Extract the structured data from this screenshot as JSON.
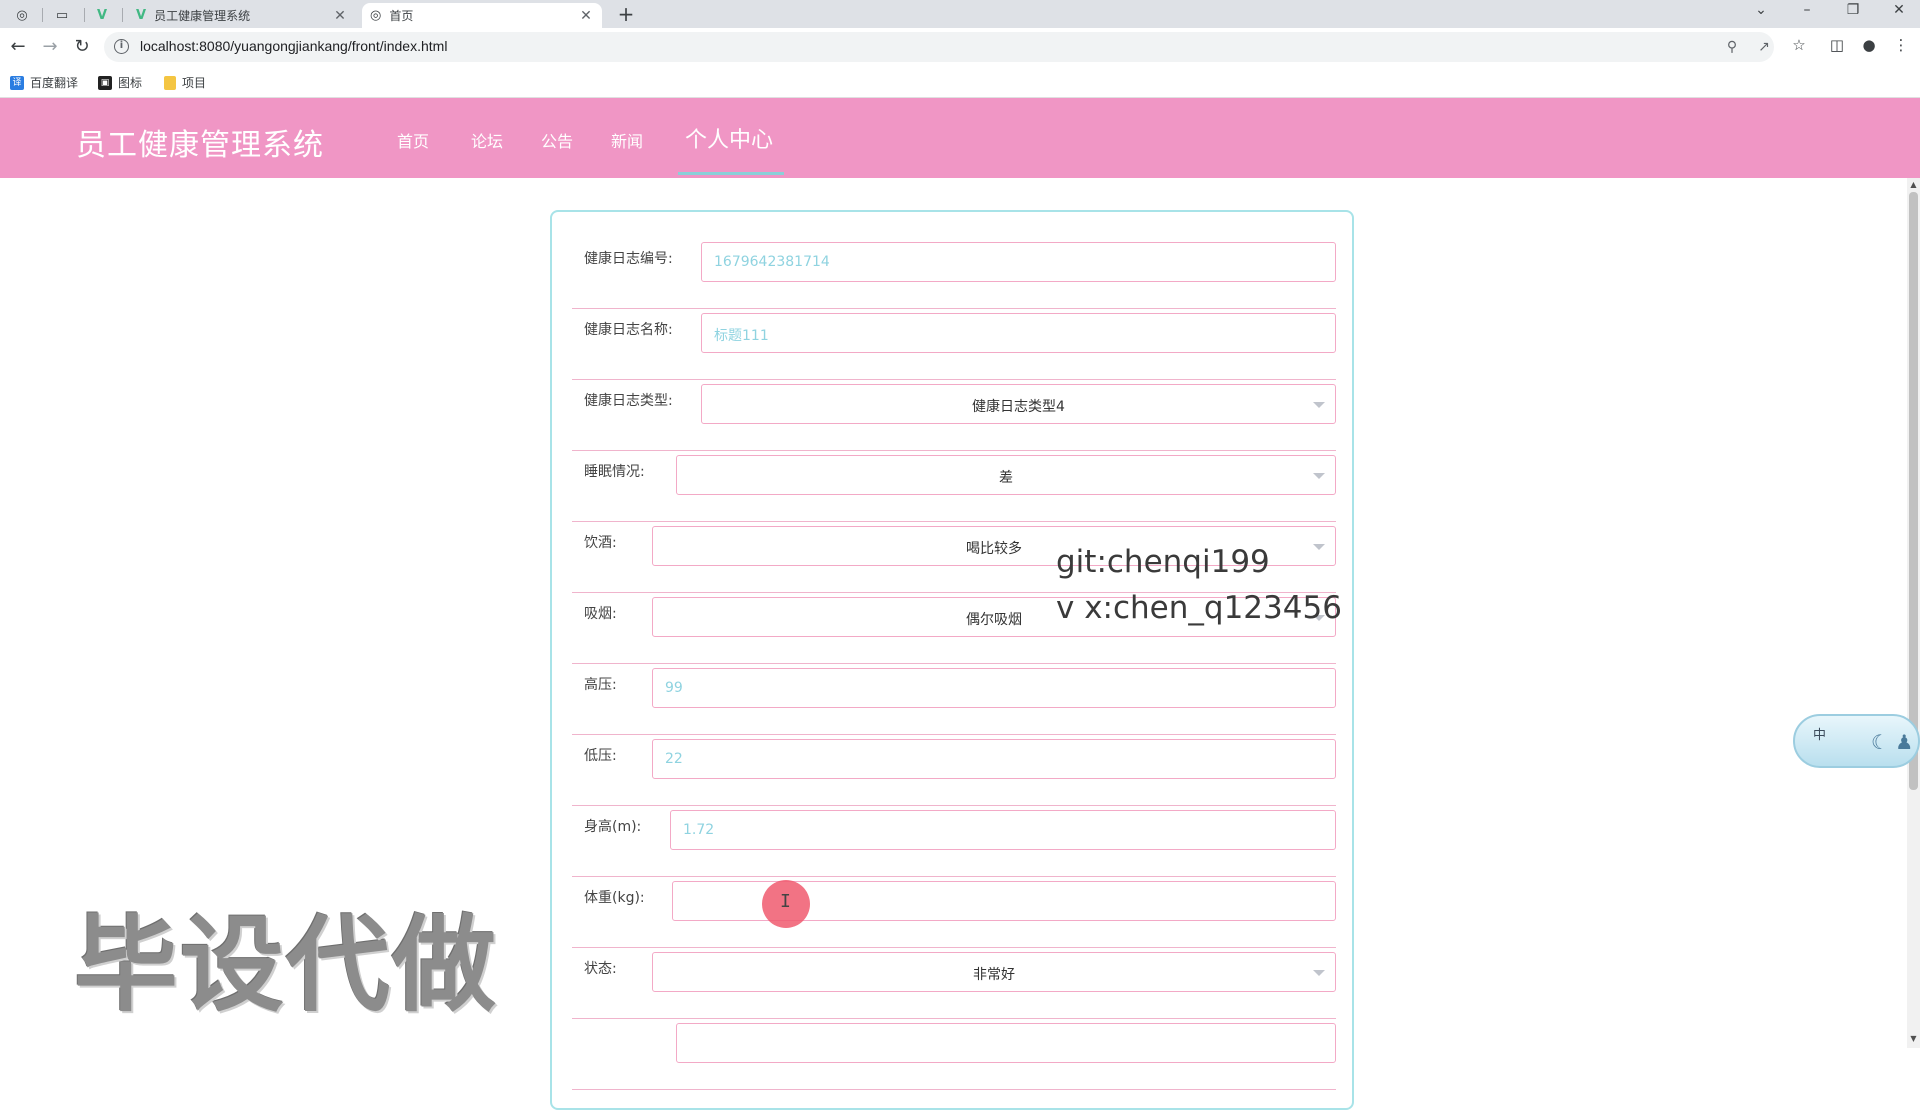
{
  "browser": {
    "tabs": [
      {
        "title": "员工健康管理系统",
        "close": "✕"
      },
      {
        "title": "首页",
        "close": "✕"
      }
    ],
    "new_tab": "+",
    "url": "localhost:8080/yuangongjiankang/front/index.html",
    "bookmarks": [
      {
        "label": "百度翻译",
        "icon_color": "#2a7de1"
      },
      {
        "label": "图标",
        "icon_color": "#222222"
      },
      {
        "label": "项目",
        "icon_color": "#f4c542"
      }
    ]
  },
  "header": {
    "title": "员工健康管理系统",
    "nav": [
      "首页",
      "论坛",
      "公告",
      "新闻",
      "个人中心"
    ],
    "active_nav": "个人中心",
    "bg_color": "#f096c5"
  },
  "form": {
    "fields": [
      {
        "label": "健康日志编号:",
        "value": "1679642381714",
        "kind": "text"
      },
      {
        "label": "健康日志名称:",
        "value": "标题111",
        "kind": "text"
      },
      {
        "label": "健康日志类型:",
        "value": "健康日志类型4",
        "kind": "select"
      },
      {
        "label": "睡眠情况:",
        "value": "差",
        "kind": "select"
      },
      {
        "label": "饮酒:",
        "value": "喝比较多",
        "kind": "select"
      },
      {
        "label": "吸烟:",
        "value": "偶尔吸烟",
        "kind": "select"
      },
      {
        "label": "高压:",
        "value": "99",
        "kind": "text"
      },
      {
        "label": "低压:",
        "value": "22",
        "kind": "text"
      },
      {
        "label": "身高(m):",
        "value": "1.72",
        "kind": "text"
      },
      {
        "label": "体重(kg):",
        "value": "",
        "kind": "text"
      },
      {
        "label": "状态:",
        "value": "非常好",
        "kind": "select"
      },
      {
        "label": "",
        "value": "",
        "kind": "text"
      }
    ]
  },
  "overlays": {
    "watermark_git": "git:chenqi199",
    "watermark_vx": "v x:chen_q123456",
    "big_watermark": "毕设代做",
    "ime_label": "中",
    "ime_deco": "☾ ♟"
  }
}
